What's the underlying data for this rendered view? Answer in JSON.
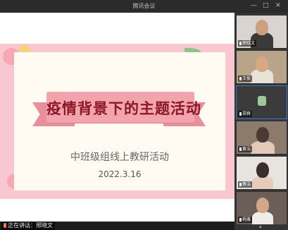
{
  "window": {
    "title": "腾讯会议",
    "minimize_glyph": "—",
    "maximize_glyph": "□",
    "close_glyph": "✕"
  },
  "slide": {
    "title": "疫情背景下的主题活动",
    "subtitle": "中班级组线上教研活动",
    "date": "2022.3.16"
  },
  "speaker": {
    "label": "正在讲话：邢晓文"
  },
  "participants": [
    {
      "name": "邢晓文",
      "active": false
    },
    {
      "name": "王俊",
      "active": false
    },
    {
      "name": "郑爽",
      "active": true
    },
    {
      "name": "黄洁",
      "active": false
    },
    {
      "name": "蔡洁",
      "active": false
    },
    {
      "name": "杨雅",
      "active": false
    }
  ],
  "colors": {
    "slide_bg": "#f8c7cf",
    "ribbon": "#f2a4ae",
    "title_text": "#8c1726",
    "active_border": "#3a7bd5"
  },
  "icons": [
    "minimize-icon",
    "maximize-icon",
    "close-icon",
    "microphone-icon",
    "scroll-down-icon"
  ]
}
